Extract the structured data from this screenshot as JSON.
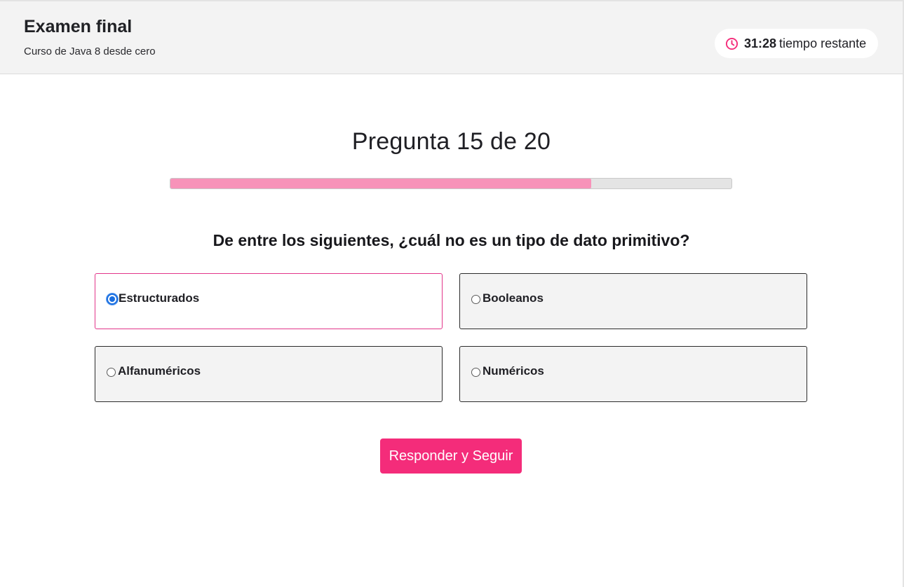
{
  "header": {
    "exam_title": "Examen final",
    "course_name": "Curso de Java 8 desde cero",
    "timer": {
      "value": "31:28",
      "label": "tiempo restante",
      "icon": "clock-icon",
      "icon_color": "#f42c7a"
    }
  },
  "quiz": {
    "counter_text": "Pregunta 15 de 20",
    "current_question": 15,
    "total_questions": 20,
    "progress_fraction": 0.75,
    "question": "De entre los siguientes, ¿cuál no es un tipo de dato primitivo?",
    "options": [
      {
        "label": "Estructurados",
        "selected": true
      },
      {
        "label": "Booleanos",
        "selected": false
      },
      {
        "label": "Alfanuméricos",
        "selected": false
      },
      {
        "label": "Numéricos",
        "selected": false
      }
    ],
    "submit_label": "Responder y Seguir"
  },
  "colors": {
    "accent": "#f42c7a",
    "progress_fill": "#f793b9",
    "selected_border": "#e2358a",
    "radio_checked": "#1b6fe0"
  }
}
